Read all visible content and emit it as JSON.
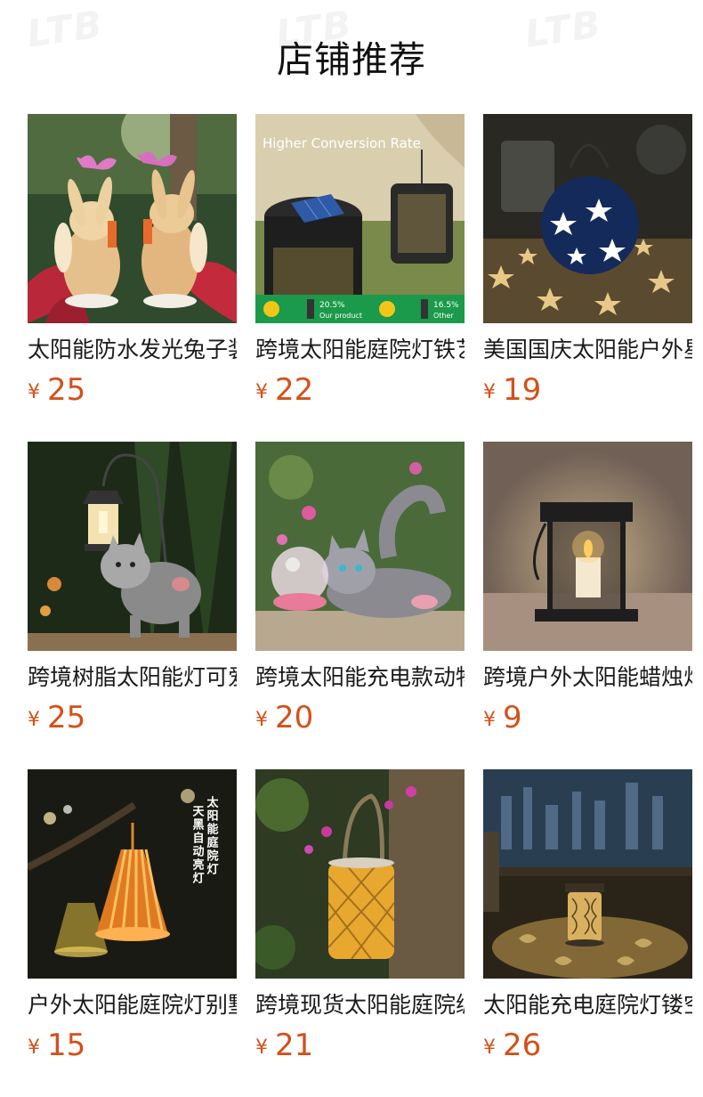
{
  "page": {
    "title": "店铺推荐",
    "watermark": "LTB"
  },
  "currency_symbol": "¥",
  "products": [
    {
      "name": "太阳能防水发光兔子装饰灯",
      "price": "25",
      "image": "rabbit-statue-solar-light",
      "image_text": []
    },
    {
      "name": "跨境太阳能庭院灯铁艺手提灯",
      "price": "22",
      "image": "solar-lantern-panel",
      "image_text": [
        "Higher Conversion Rate",
        "20.5%",
        "Our product",
        "16.5%",
        "Other"
      ]
    },
    {
      "name": "美国国庆太阳能户外星星灯",
      "price": "19",
      "image": "star-projection-lantern",
      "image_text": []
    },
    {
      "name": "跨境树脂太阳能灯可爱猫咪",
      "price": "25",
      "image": "cat-statue-hanging-lantern",
      "image_text": []
    },
    {
      "name": "跨境太阳能充电款动物灯",
      "price": "20",
      "image": "cat-with-glass-ball",
      "image_text": []
    },
    {
      "name": "跨境户外太阳能蜡烛灯",
      "price": "9",
      "image": "candle-lantern",
      "image_text": []
    },
    {
      "name": "户外太阳能庭院灯别墅装饰",
      "price": "15",
      "image": "bamboo-pendant-lamp",
      "image_text": [
        "太阳能庭院灯",
        "天黑自动亮灯"
      ]
    },
    {
      "name": "跨境现货太阳能庭院编织灯",
      "price": "21",
      "image": "woven-lantern-flowers",
      "image_text": []
    },
    {
      "name": "太阳能充电庭院灯镂空投影",
      "price": "26",
      "image": "projection-lantern-balcony",
      "image_text": []
    }
  ]
}
